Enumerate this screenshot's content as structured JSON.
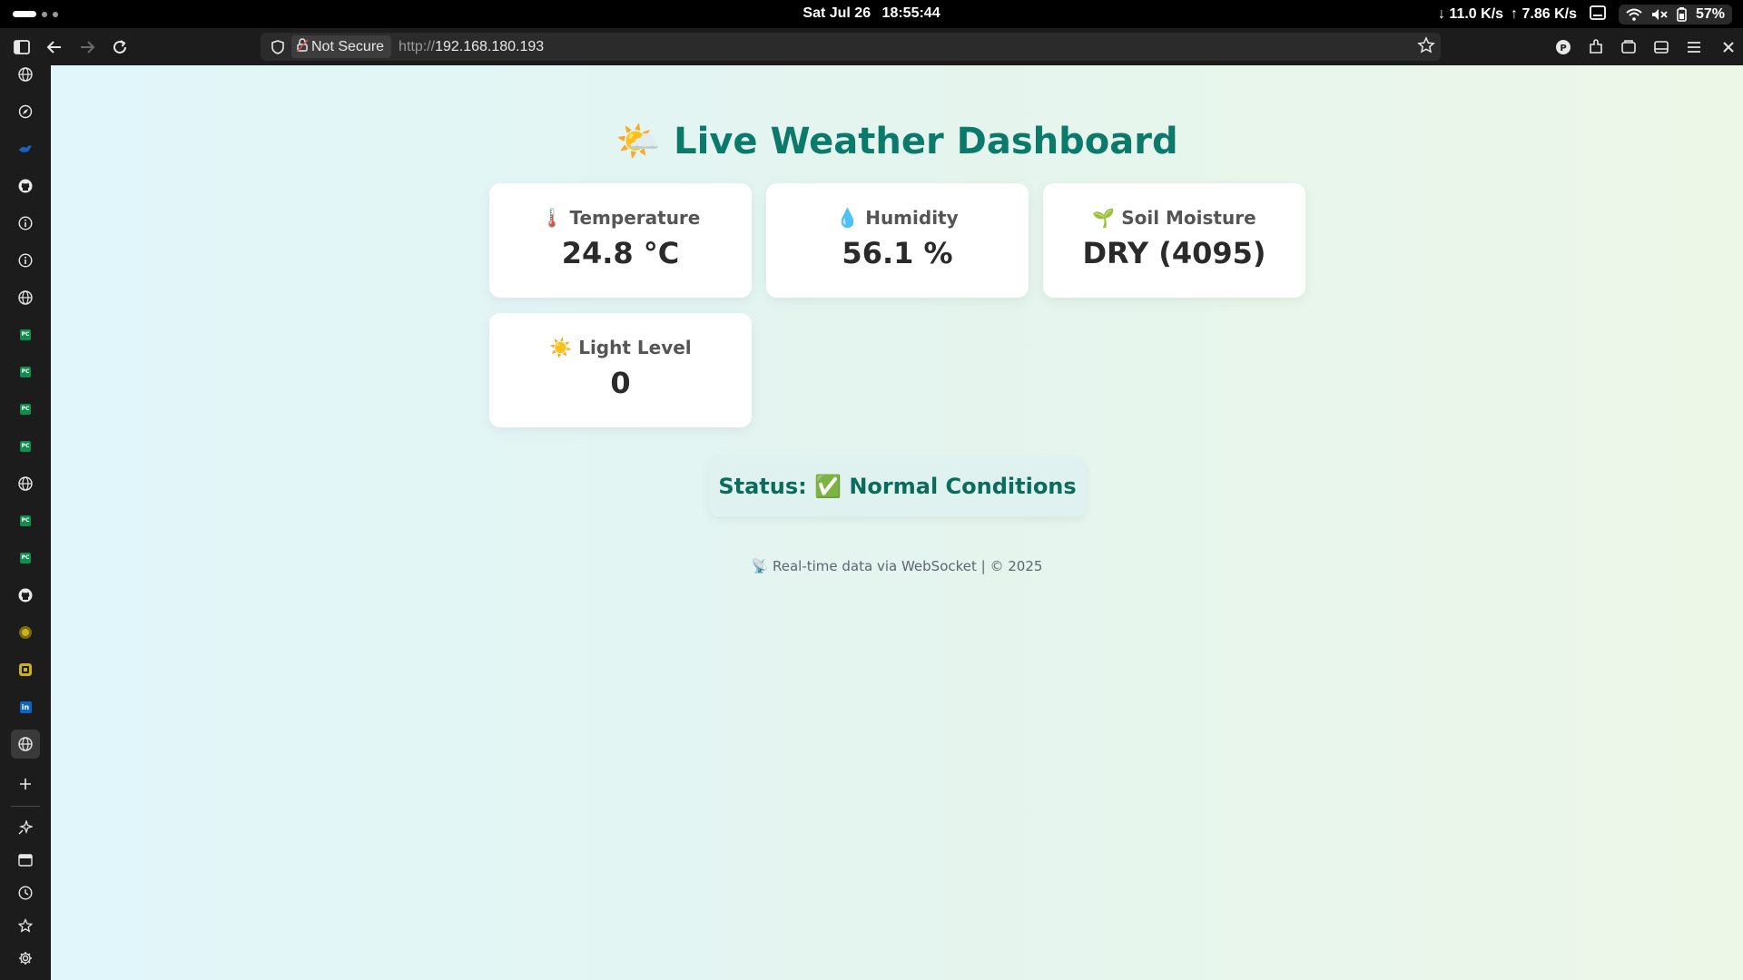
{
  "system_bar": {
    "date": "Sat Jul 26",
    "time": "18:55:44",
    "download": "↓ 11.0 K/s",
    "upload": "↑ 7.86 K/s",
    "battery": "57%"
  },
  "browser": {
    "security_label": "Not Secure",
    "url_protocol": "http://",
    "url_host": "192.168.180.193"
  },
  "sidebar": {
    "items": [
      "globe-icon",
      "compass-icon",
      "bird-icon",
      "github-icon",
      "info-icon",
      "info-icon",
      "globe-icon",
      "pycharm-icon",
      "pycharm-icon",
      "pycharm-icon",
      "pycharm-icon",
      "globe-icon",
      "pycharm-icon",
      "pycharm-icon",
      "github-icon",
      "chip-icon",
      "chip-icon",
      "linkedin-icon",
      "globe-icon"
    ],
    "linkedin_label": "in",
    "pycharm_label": "PC"
  },
  "dashboard": {
    "title_emoji": "🌤️",
    "title": "Live Weather Dashboard",
    "cards": [
      {
        "emoji": "🌡️",
        "label": "Temperature",
        "value": "24.8 °C"
      },
      {
        "emoji": "💧",
        "label": "Humidity",
        "value": "56.1 %"
      },
      {
        "emoji": "🌱",
        "label": "Soil Moisture",
        "value": "DRY (4095)"
      },
      {
        "emoji": "☀️",
        "label": "Light Level",
        "value": "0"
      }
    ],
    "status_prefix": "Status:",
    "status_emoji": "✅",
    "status_text": "Normal Conditions",
    "footer": "📡 Real-time data via WebSocket | © 2025"
  },
  "colors": {
    "accent": "#0b7a6a",
    "status_bg": "#dff2f0",
    "card_bg": "#ffffff"
  }
}
